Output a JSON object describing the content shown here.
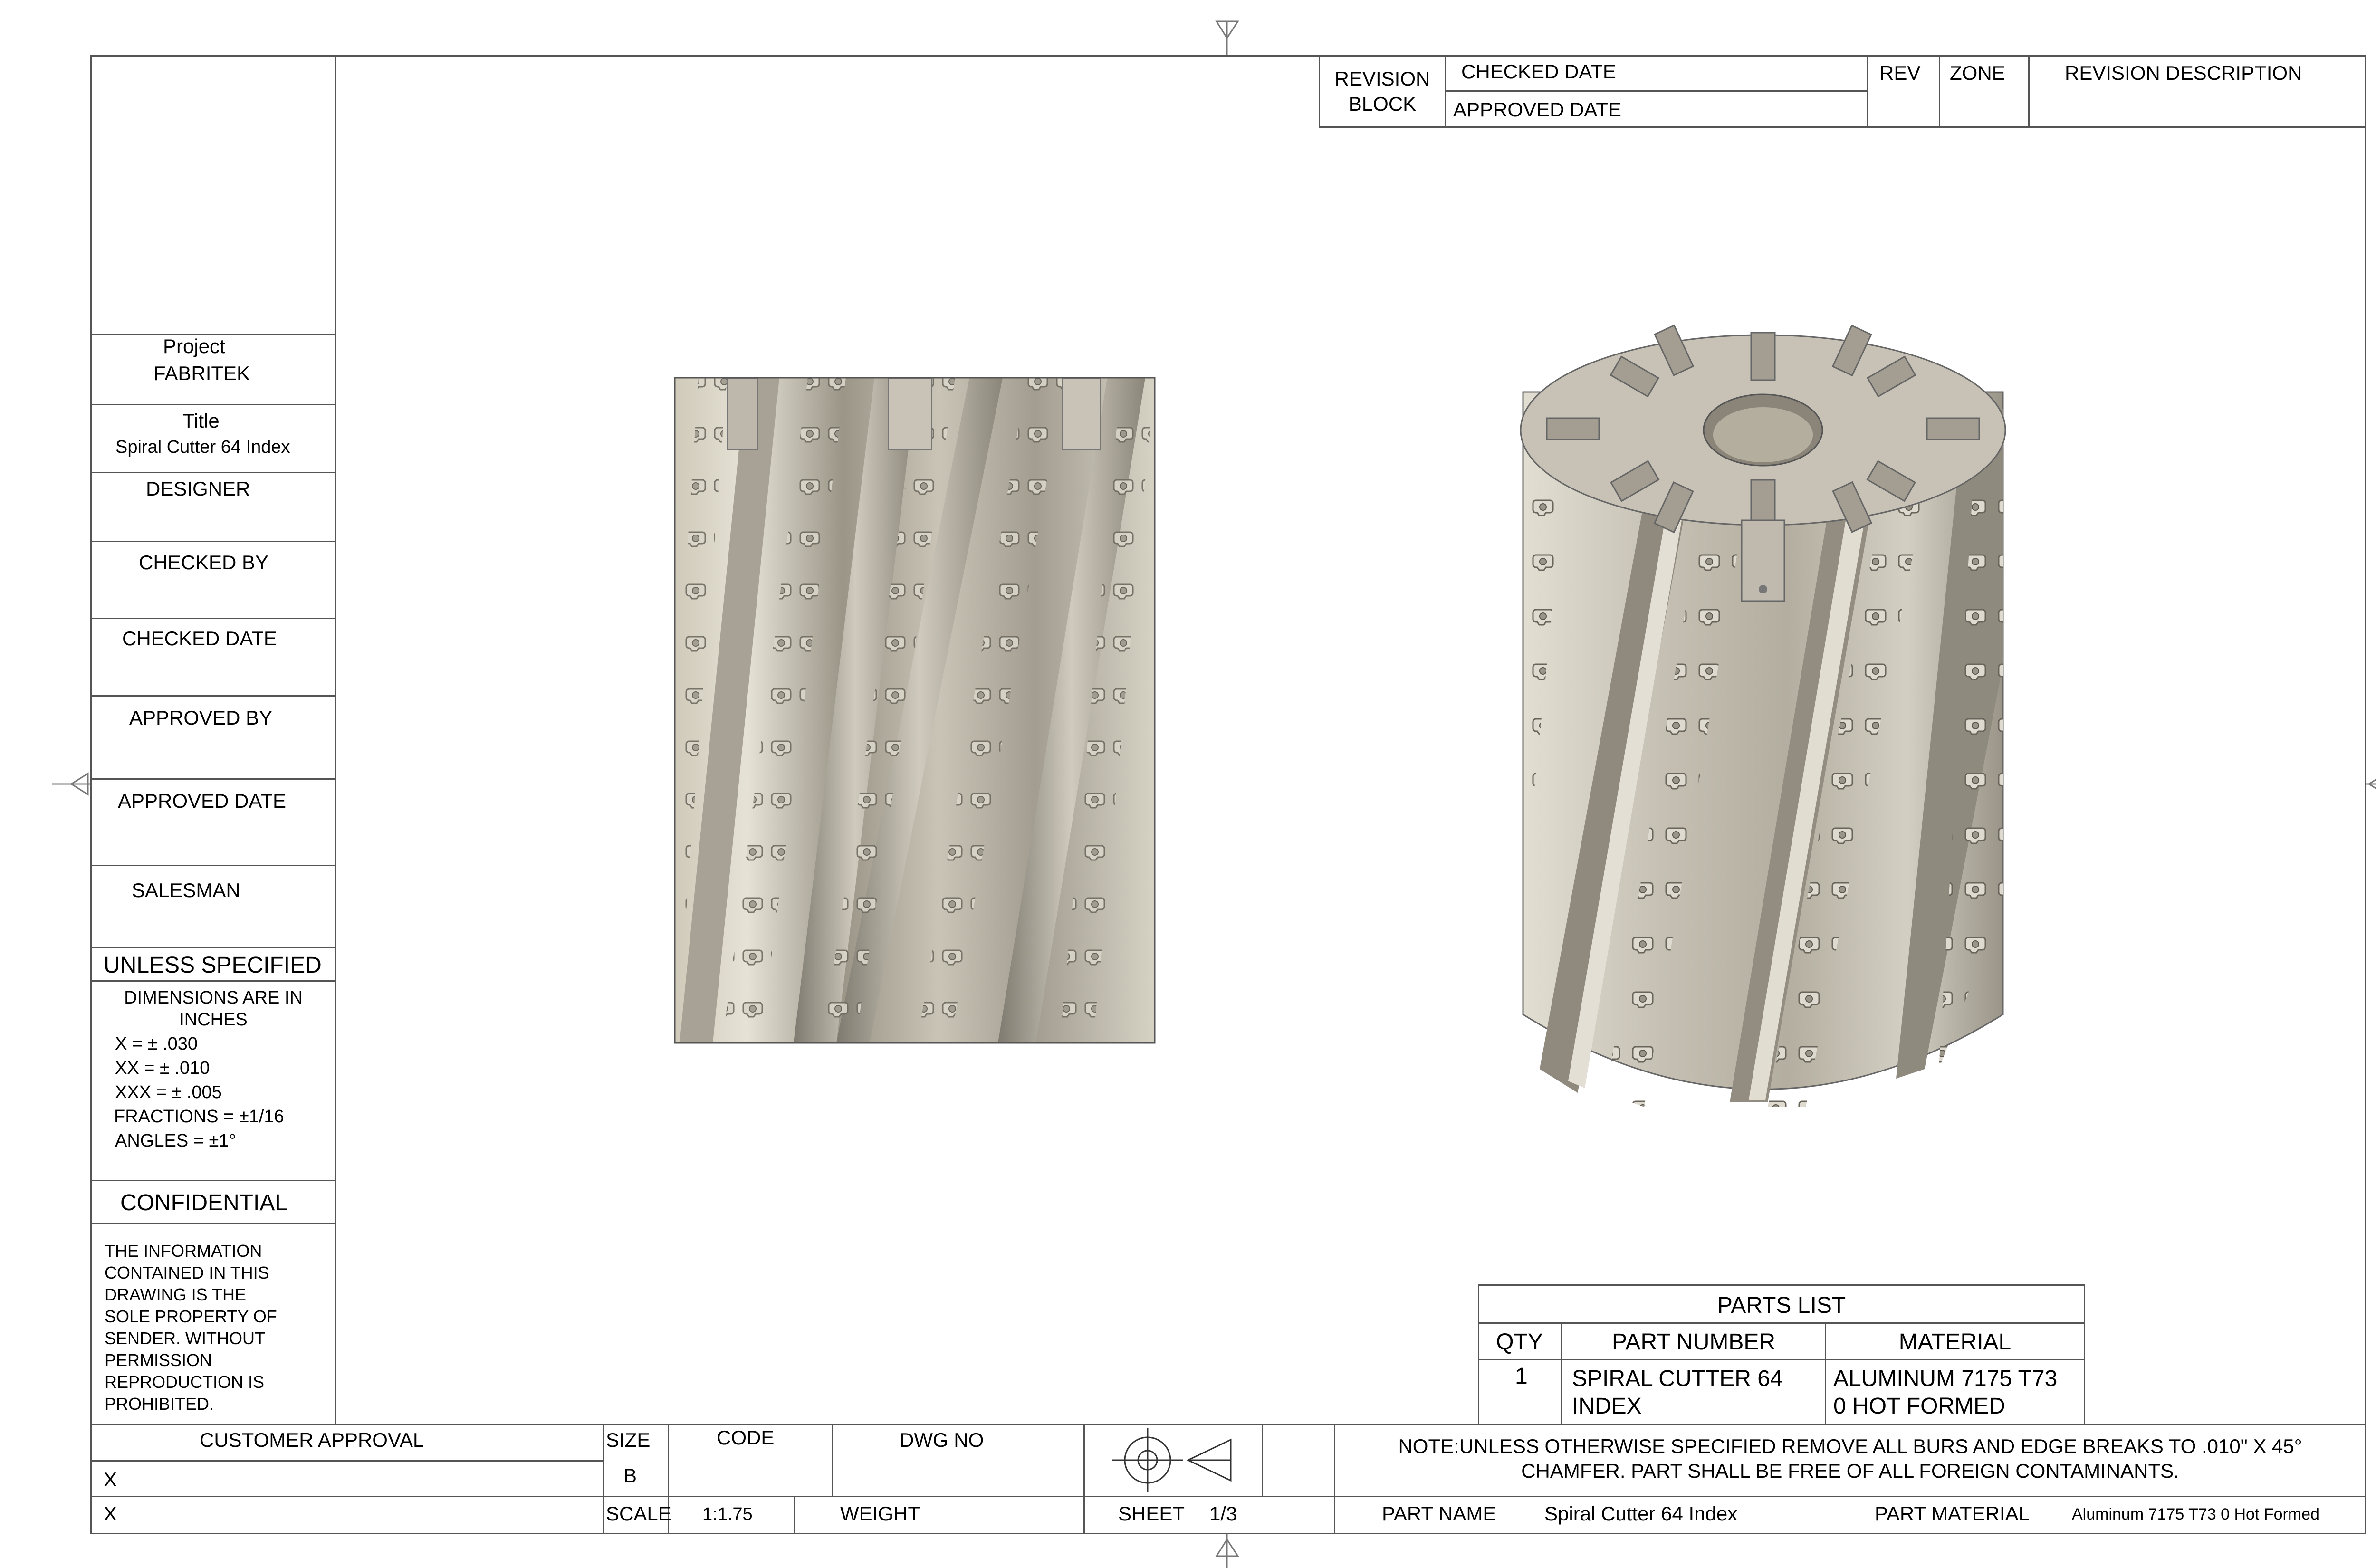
{
  "revision_block": {
    "label": "REVISION BLOCK",
    "checked_date": "CHECKED DATE",
    "approved_date": "APPROVED DATE",
    "rev": "REV",
    "zone": "ZONE",
    "description": "REVISION DESCRIPTION"
  },
  "left_panel": {
    "project_label": "Project",
    "project_value": "FABRITEK",
    "title_label": "Title",
    "title_value": "Spiral Cutter 64 Index",
    "designer": "DESIGNER",
    "checked_by": "CHECKED BY",
    "checked_date": "CHECKED DATE",
    "approved_by": "APPROVED BY",
    "approved_date": "APPROVED DATE",
    "salesman": "SALESMAN",
    "unless_specified": "UNLESS SPECIFIED",
    "dims_line1": "DIMENSIONS ARE IN",
    "dims_line2": "INCHES",
    "tol_x": "X = ± .030",
    "tol_xx": "XX = ± .010",
    "tol_xxx": "XXX = ± .005",
    "tol_frac": "FRACTIONS = ±1/16",
    "tol_angles": "ANGLES = ±1°",
    "confidential": "CONFIDENTIAL",
    "conf_lines": [
      "THE INFORMATION",
      "CONTAINED IN THIS",
      "DRAWING IS THE",
      "SOLE PROPERTY OF",
      "SENDER. WITHOUT",
      "PERMISSION",
      "REPRODUCTION IS",
      "PROHIBITED."
    ]
  },
  "parts_list": {
    "title": "PARTS LIST",
    "headers": [
      "QTY",
      "PART NUMBER",
      "MATERIAL"
    ],
    "rows": [
      {
        "qty": "1",
        "part_line1": "SPIRAL CUTTER 64",
        "part_line2": "INDEX",
        "mat_line1": "ALUMINUM 7175 T73",
        "mat_line2": "0 HOT FORMED"
      }
    ]
  },
  "title_block": {
    "customer_approval": "CUSTOMER APPROVAL",
    "x1": "X",
    "x2": "X",
    "size_label": "SIZE",
    "size_value": "B",
    "code_label": "CODE",
    "dwg_no_label": "DWG NO",
    "scale_label": "SCALE",
    "scale_value": "1:1.75",
    "weight_label": "WEIGHT",
    "sheet_label": "SHEET",
    "sheet_value": "1/3",
    "note_line1": "NOTE:UNLESS OTHERWISE SPECIFIED REMOVE ALL BURS AND EDGE BREAKS TO .010\" X 45°",
    "note_line2": "CHAMFER. PART SHALL BE FREE OF ALL FOREIGN CONTAMINANTS.",
    "part_name_label": "PART NAME",
    "part_name_value": "Spiral Cutter 64 Index",
    "part_material_label": "PART MATERIAL",
    "part_material_value": "Aluminum 7175 T73 0 Hot Formed"
  },
  "colors": {
    "border": "#555555",
    "metal_light": "#d8d4ca",
    "metal_mid": "#b9b4a8",
    "metal_dark": "#8e897e"
  }
}
